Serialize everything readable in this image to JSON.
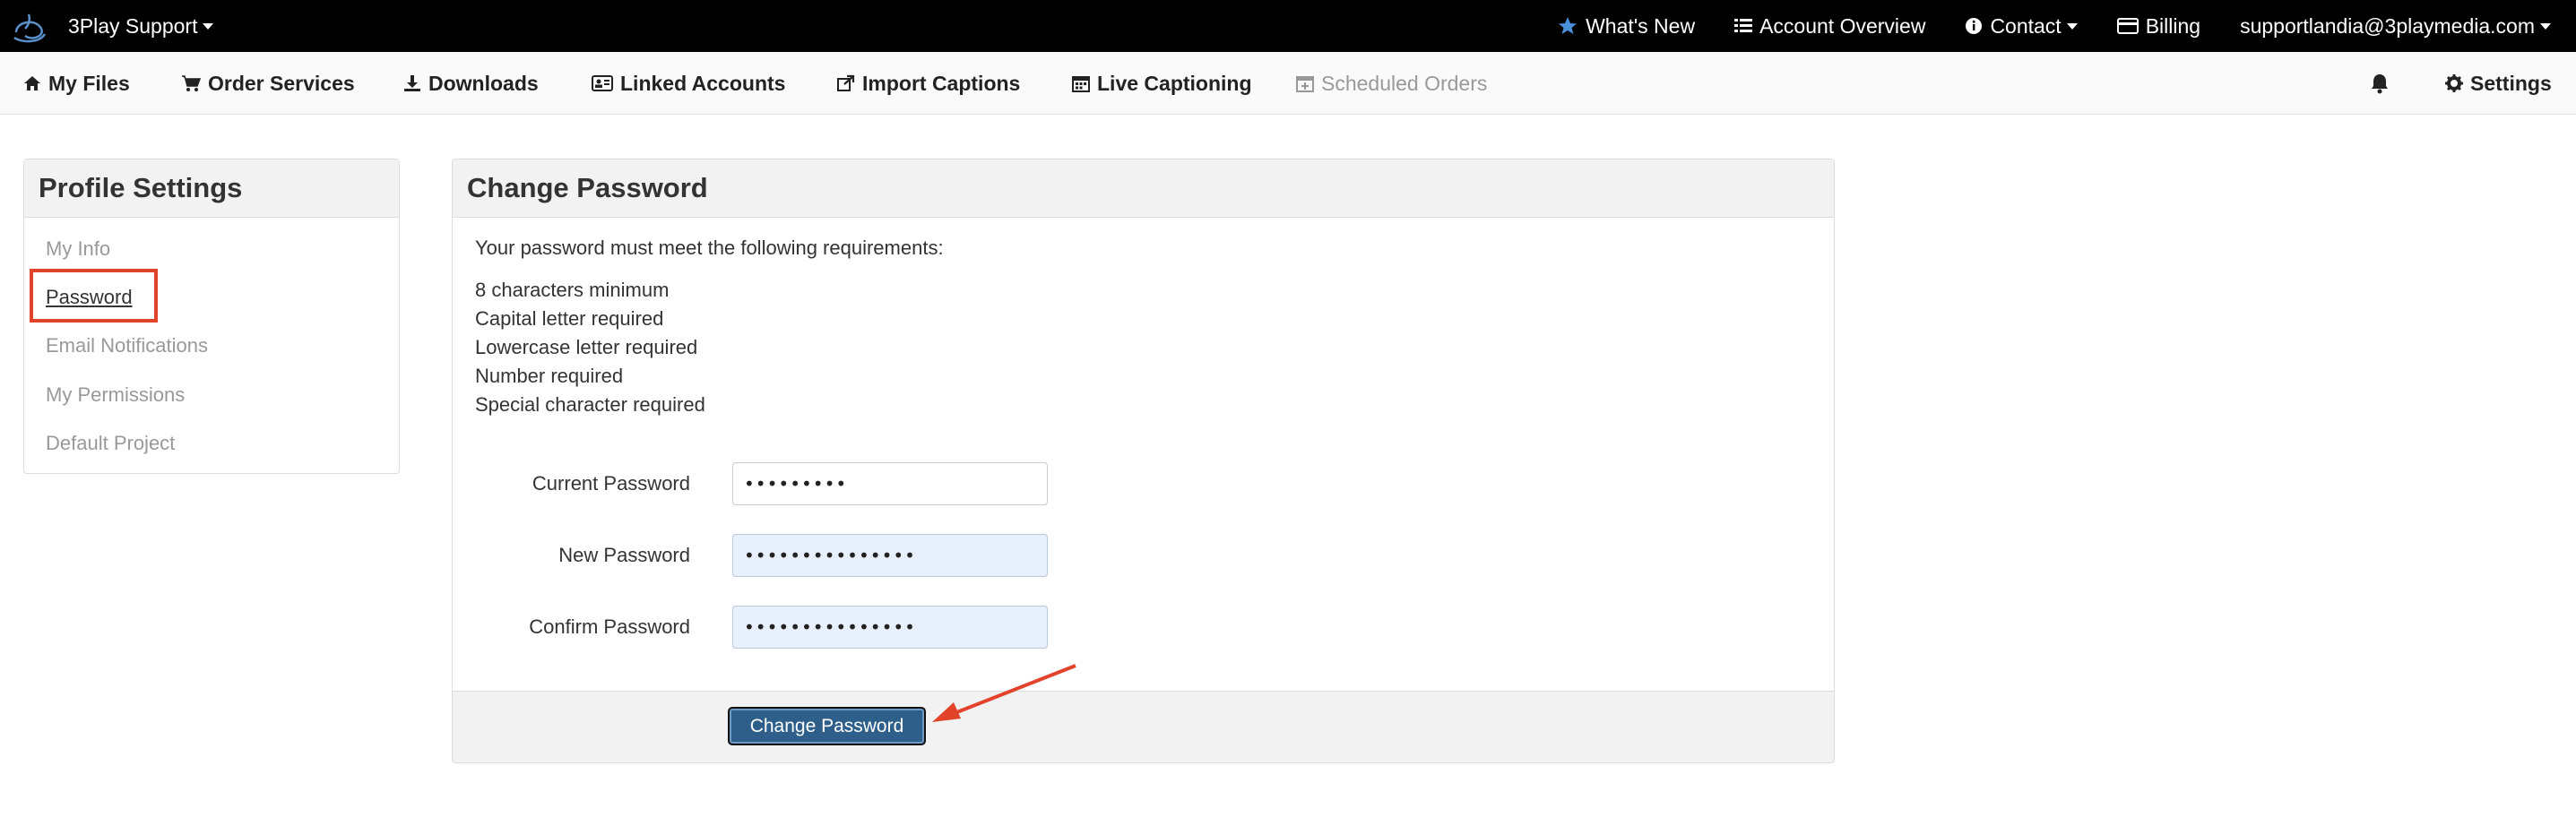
{
  "topbar": {
    "brand": "3Play Support",
    "items": [
      {
        "label": "What's New",
        "icon": "star-icon"
      },
      {
        "label": "Account Overview",
        "icon": "list-icon"
      },
      {
        "label": "Contact",
        "icon": "info-icon"
      },
      {
        "label": "Billing",
        "icon": "credit-card-icon"
      },
      {
        "label": "supportlandia@3playmedia.com",
        "icon": ""
      }
    ]
  },
  "subnav": {
    "items": [
      {
        "label": "My Files",
        "icon": "home-icon"
      },
      {
        "label": "Order Services",
        "icon": "cart-icon"
      },
      {
        "label": "Downloads",
        "icon": "download-icon"
      },
      {
        "label": "Linked Accounts",
        "icon": "id-card-icon"
      },
      {
        "label": "Import Captions",
        "icon": "share-icon"
      },
      {
        "label": "Live Captioning",
        "icon": "calendar-icon"
      },
      {
        "label": "Scheduled Orders",
        "icon": "calendar-plus-icon"
      }
    ],
    "settings": "Settings"
  },
  "sidebar": {
    "title": "Profile Settings",
    "items": [
      {
        "label": "My Info"
      },
      {
        "label": "Password"
      },
      {
        "label": "Email Notifications"
      },
      {
        "label": "My Permissions"
      },
      {
        "label": "Default Project"
      }
    ]
  },
  "main": {
    "title": "Change Password",
    "intro": "Your password must meet the following requirements:",
    "requirements": [
      "8 characters minimum",
      "Capital letter required",
      "Lowercase letter required",
      "Number required",
      "Special character required"
    ],
    "fields": [
      {
        "label": "Current Password",
        "value": "•••••••••"
      },
      {
        "label": "New Password",
        "value": "•••••••••••••••"
      },
      {
        "label": "Confirm Password",
        "value": "•••••••••••••••"
      }
    ],
    "submit": "Change Password"
  },
  "colors": {
    "accent": "#2e5f8a",
    "highlight": "#e2432b",
    "star": "#4a90d9"
  }
}
